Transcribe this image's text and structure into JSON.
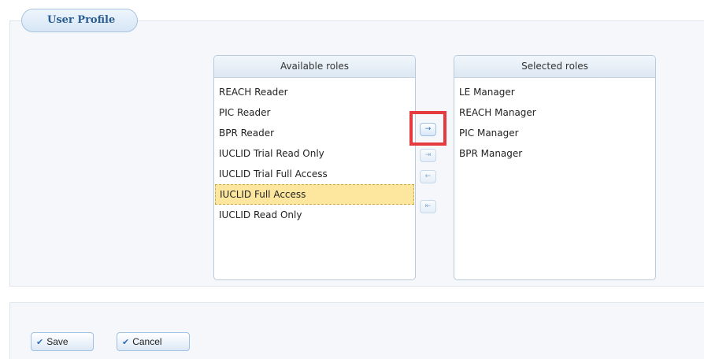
{
  "profile": {
    "tab_label": "User Profile"
  },
  "available_roles": {
    "header": "Available roles",
    "items": [
      "REACH Reader",
      "PIC Reader",
      "BPR Reader",
      "IUCLID Trial Read Only",
      "IUCLID Trial Full Access",
      "IUCLID Full Access",
      "IUCLID Read Only"
    ],
    "active_item": "IUCLID Full Access"
  },
  "selected_roles": {
    "header": "Selected roles",
    "items": [
      "LE Manager",
      "REACH Manager",
      "PIC Manager",
      "BPR Manager"
    ]
  },
  "transfer_buttons": {
    "add": "→",
    "add_all": "⇥",
    "remove": "←",
    "remove_all": "⇤"
  },
  "actions": {
    "save_label": "Save",
    "cancel_label": "Cancel",
    "check_icon": "✔"
  },
  "colors": {
    "accent": "#2c5d90",
    "highlight_box": "#e53b3f",
    "active_row": "#fde79e"
  }
}
